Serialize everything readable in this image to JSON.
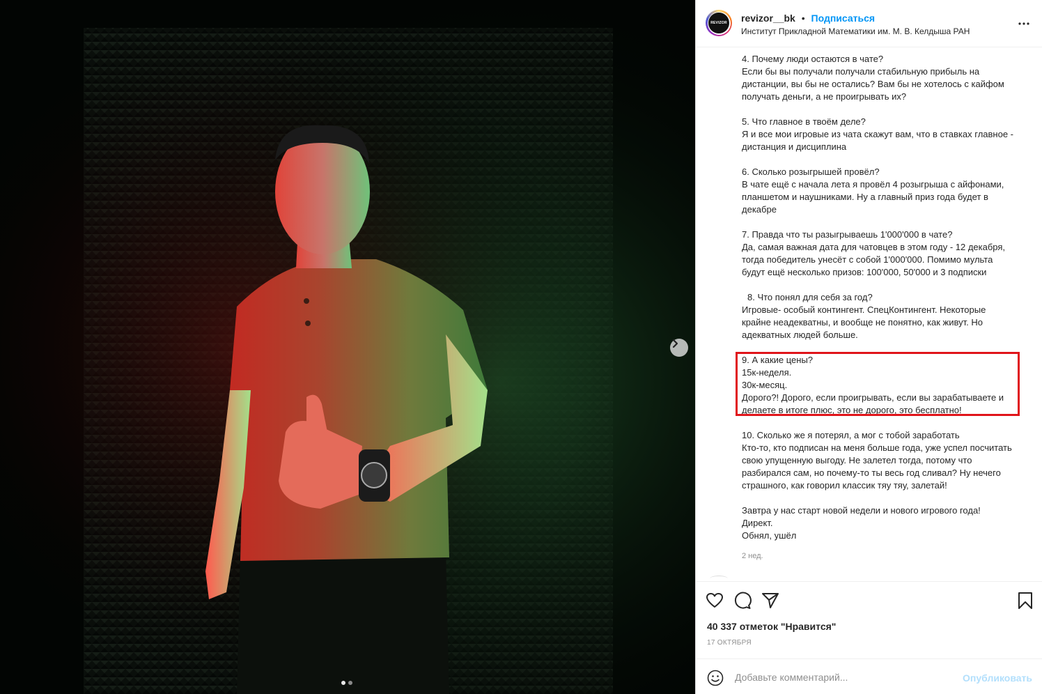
{
  "header": {
    "avatar_text": "REVIZOR",
    "username": "revizor__bk",
    "separator": "•",
    "follow_label": "Подписаться",
    "location": "Институт Прикладной Математики им. М. В. Келдыша РАН"
  },
  "caption": {
    "p4": {
      "l1": "4. Почему люди остаются в чате?",
      "l2": "Если бы вы получали получали стабильную прибыль на",
      "l3": "дистанции, вы бы не остались? Вам бы не хотелось с кайфом",
      "l4": "получать деньги, а не проигрывать их?"
    },
    "p5": {
      "l1": "5. Что главное в твоём деле?",
      "l2": "Я и все мои игровые из чата скажут вам, что в ставках главное -",
      "l3": "дистанция и дисциплина"
    },
    "p6": {
      "l1": "6. Сколько розыгрышей провёл?",
      "l2": "В чате ещё с начала лета я провёл 4 розыгрыша с айфонами,",
      "l3": "планшетом и наушниками. Ну а главный приз года будет в",
      "l4": "декабре"
    },
    "p7": {
      "l1": "7. Правда что ты разыгрываешь 1'000'000 в чате?",
      "l2": "Да, самая важная дата для чатовцев в этом году - 12 декабря,",
      "l3": "тогда победитель унесёт с собой 1'000'000. Помимо мульта",
      "l4": "будут ещё несколько призов: 100'000, 50'000 и 3 подписки"
    },
    "p8": {
      "l1": "8. Что понял для себя за год?",
      "l2": "Игровые- особый контингент. СпецКонтингент. Некоторые",
      "l3": "крайне неадекватны, и вообще не понятно, как живут. Но",
      "l4": "адекватных людей больше."
    },
    "p9": {
      "l1": "9. А какие цены?",
      "l2": "15к-неделя.",
      "l3": "30к-месяц.",
      "l4": "Дорого?! Дорого, если проигрывать, если вы зарабатываете и",
      "l5": "делаете в итоге плюс, это не дорого, это бесплатно!"
    },
    "p10": {
      "l1": "10. Сколько же я потерял, а мог с тобой заработать",
      "l2": "Кто-то, кто подписан на меня больше года, уже успел посчитать",
      "l3": "свою упущенную выгоду. Не залетел тогда, потому что",
      "l4": "разбирался сам, но почему-то ты весь год сливал? Ну нечего",
      "l5": "страшного, как говорил классик тяу тяу, залетай!"
    },
    "p11": {
      "l1": "Завтра у нас старт новой недели и нового игрового года!",
      "l2": "Директ.",
      "l3": "Обнял, ушёл"
    },
    "age": "2 нед."
  },
  "actions": {
    "likes": "40 337 отметок \"Нравится\"",
    "date": "17 октября"
  },
  "comment": {
    "placeholder": "Добавьте комментарий...",
    "publish_label": "Опубликовать"
  },
  "media": {
    "slide_count": 2,
    "active_slide": 1
  },
  "colors": {
    "follow": "#0095f6",
    "highlight": "#e0141a",
    "publish_disabled": "#b2dffc"
  }
}
